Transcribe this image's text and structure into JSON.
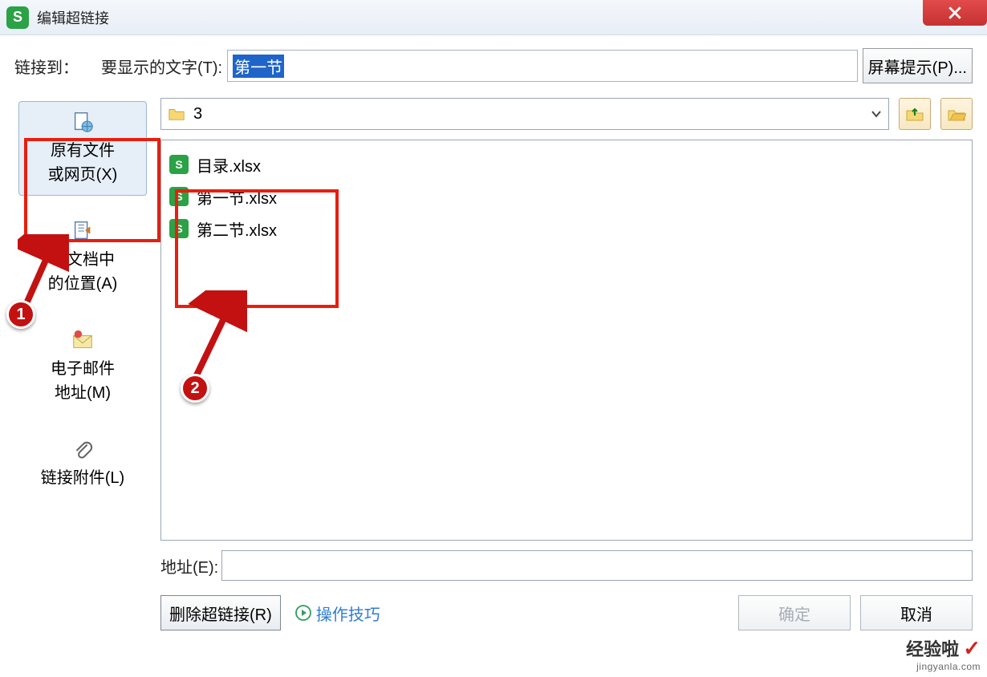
{
  "title": "编辑超链接",
  "linkToLabel": "链接到：",
  "displayLabel": "要显示的文字(T):",
  "displayValue": "第一节",
  "screenTipLabel": "屏幕提示(P)...",
  "sidebar": [
    {
      "label": "原有文件\n或网页(X)"
    },
    {
      "label": "本文档中\n的位置(A)"
    },
    {
      "label": "电子邮件\n地址(M)"
    },
    {
      "label": "链接附件(L)"
    }
  ],
  "folderName": "3",
  "files": [
    {
      "name": "目录.xlsx"
    },
    {
      "name": "第一节.xlsx"
    },
    {
      "name": "第二节.xlsx"
    }
  ],
  "addressLabel": "地址(E):",
  "addressValue": "",
  "removeLinkLabel": "删除超链接(R)",
  "tipsLabel": "操作技巧",
  "okLabel": "确定",
  "cancelLabel": "取消",
  "annot1": "1",
  "annot2": "2",
  "watermark1": "经验啦",
  "watermark2": "jingyanla.com"
}
